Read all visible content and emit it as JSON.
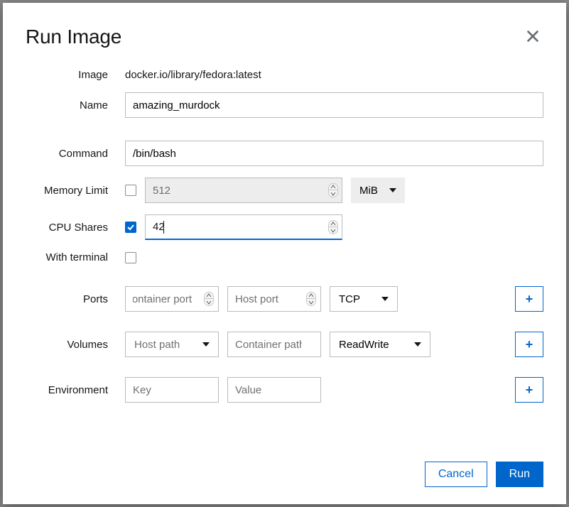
{
  "title": "Run Image",
  "labels": {
    "image": "Image",
    "name": "Name",
    "command": "Command",
    "memory_limit": "Memory Limit",
    "cpu_shares": "CPU Shares",
    "with_terminal": "With terminal",
    "ports": "Ports",
    "volumes": "Volumes",
    "environment": "Environment"
  },
  "image_value": "docker.io/library/fedora:latest",
  "name_value": "amazing_murdock",
  "command_value": "/bin/bash",
  "memory": {
    "enabled": false,
    "value": "512",
    "unit": "MiB"
  },
  "cpu": {
    "enabled": true,
    "value": "42"
  },
  "with_terminal": false,
  "ports": {
    "container_placeholder": "Container port",
    "host_placeholder": "Host port",
    "protocol": "TCP"
  },
  "volumes": {
    "host_placeholder": "Host path",
    "container_placeholder": "Container path",
    "mode": "ReadWrite"
  },
  "environment": {
    "key_placeholder": "Key",
    "value_placeholder": "Value"
  },
  "buttons": {
    "cancel": "Cancel",
    "run": "Run",
    "add": "+"
  }
}
